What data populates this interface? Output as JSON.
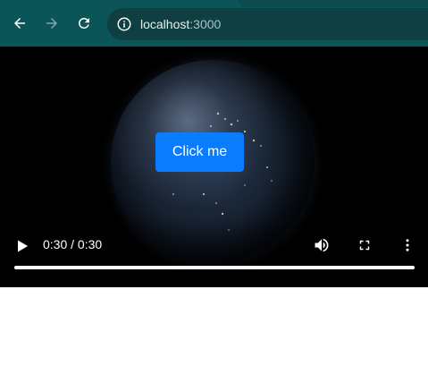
{
  "browser": {
    "url_host": "localhost",
    "url_port": ":3000",
    "back_icon": "arrow-left-icon",
    "forward_icon": "arrow-right-icon",
    "reload_icon": "reload-icon",
    "info_icon": "info-icon",
    "toolbar_color": "#0b5458"
  },
  "page": {
    "button_label": "Click me",
    "button_color": "#0a7cff"
  },
  "video": {
    "time_display": "0:30 / 0:30",
    "progress": 1.0,
    "state": "paused",
    "icons": {
      "play": "play-icon",
      "volume": "volume-icon",
      "fullscreen": "fullscreen-icon",
      "more": "more-options-icon"
    }
  }
}
